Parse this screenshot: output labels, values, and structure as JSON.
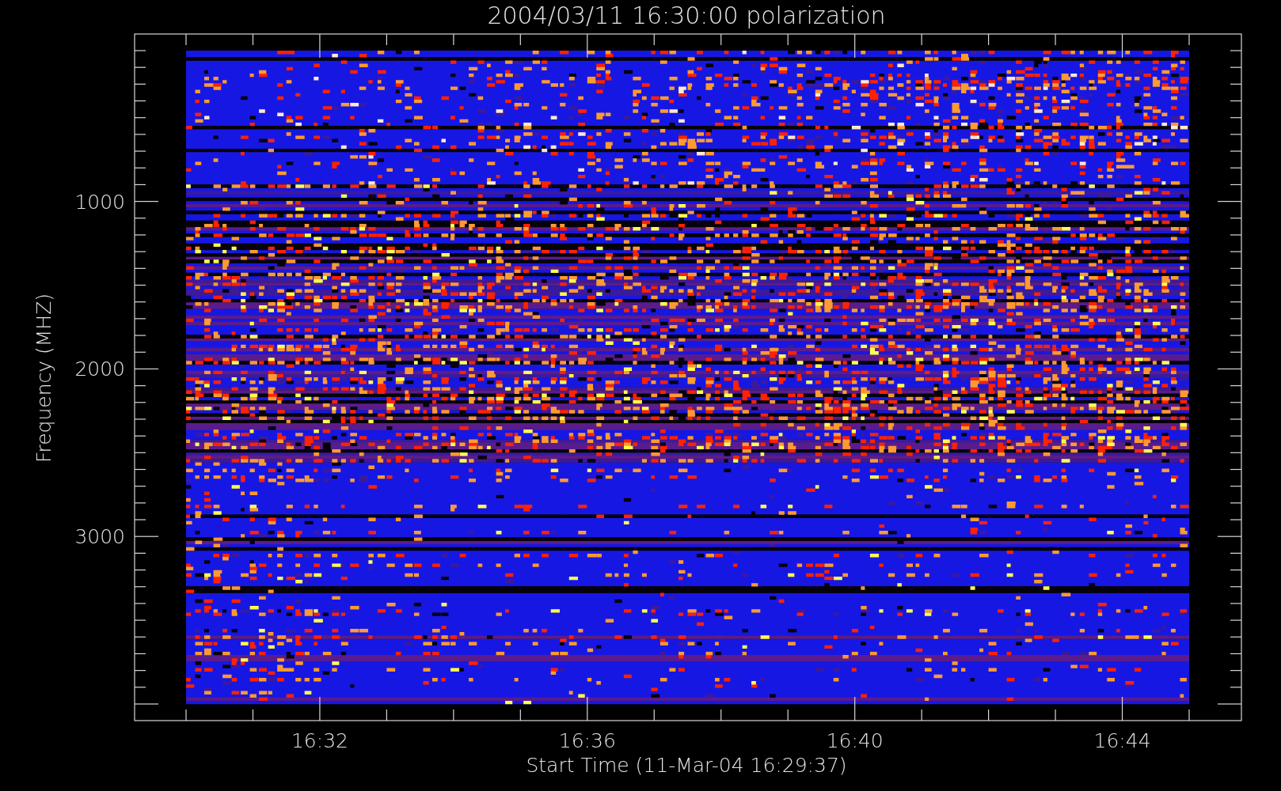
{
  "plot": {
    "title": "2004/03/11 16:30:00 polarization",
    "ylabel": "Frequency (MHZ)",
    "xlabel": "Start Time (11-Mar-04 16:29:37)",
    "ytick_labels": [
      "1000",
      "2000",
      "3000"
    ],
    "xtick_labels": [
      "16:32",
      "16:36",
      "16:40",
      "16:44"
    ]
  }
}
